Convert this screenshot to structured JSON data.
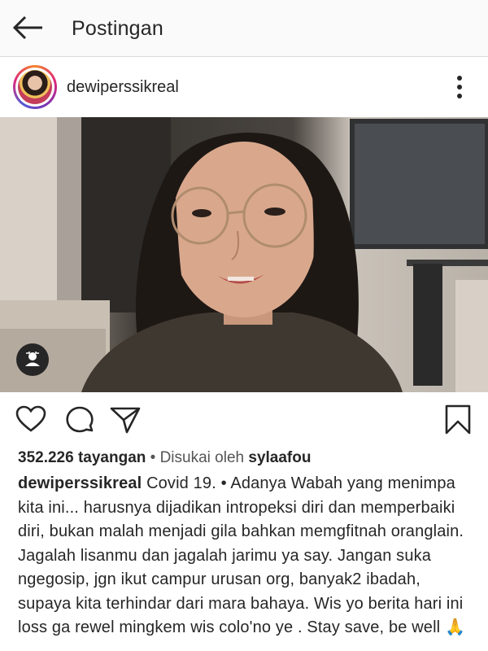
{
  "header": {
    "title": "Postingan"
  },
  "post": {
    "username": "dewiperssikreal",
    "views_count": "352.226 tayangan",
    "liked_by_prefix": "• Disukai oleh",
    "liked_by_user": "sylaafou",
    "caption_user": "dewiperssikreal",
    "caption_text": "Covid 19. • Adanya Wabah yang menimpa kita ini... harusnya dijadikan intropeksi diri dan memperbaiki diri, bukan malah menjadi gila bahkan memgfitnah oranglain. Jagalah lisanmu dan jagalah jarimu ya say. Jangan suka ngegosip, jgn ikut campur urusan org, banyak2 ibadah, supaya kita terhindar dari mara bahaya. Wis yo berita hari ini loss ga rewel mingkem wis colo'no ye . Stay save, be well 🙏"
  },
  "icons": {
    "back": "arrow-left-icon",
    "more": "vertical-dots-icon",
    "tag": "user-tag-icon",
    "like": "heart-icon",
    "comment": "comment-icon",
    "share": "send-icon",
    "save": "bookmark-icon"
  },
  "colors": {
    "text": "#262626",
    "topbar_bg": "#fafafa",
    "divider": "#dbdbdb"
  }
}
